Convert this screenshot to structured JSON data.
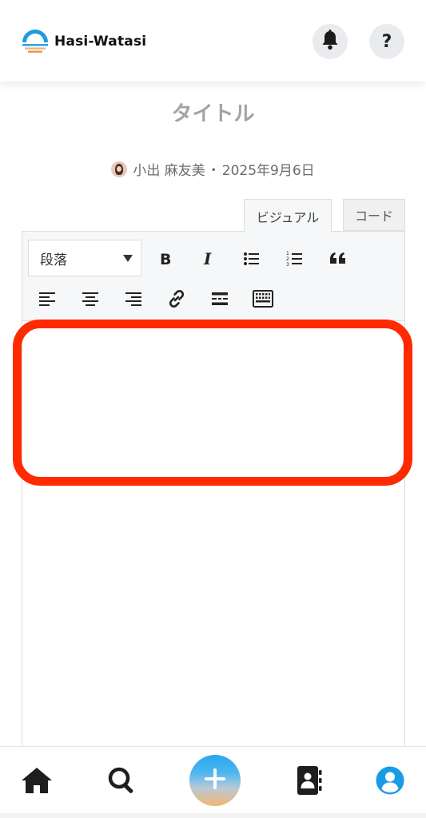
{
  "app": {
    "name": "Hasi-Watasi"
  },
  "header": {
    "notifications_icon": "bell-icon",
    "help_label": "?"
  },
  "post": {
    "title_placeholder": "タイトル",
    "author": "小出 麻友美",
    "separator": "・",
    "date": "2025年9月6日"
  },
  "editor": {
    "tabs": [
      {
        "label": "ビジュアル",
        "active": true
      },
      {
        "label": "コード",
        "active": false
      }
    ],
    "format_select": {
      "value": "段落"
    },
    "toolbar_row1": [
      "bold-icon",
      "italic-icon",
      "bulleted-list-icon",
      "numbered-list-icon",
      "blockquote-icon"
    ],
    "toolbar_row2": [
      "align-left-icon",
      "align-center-icon",
      "align-right-icon",
      "link-icon",
      "read-more-icon",
      "toolbar-toggle-icon"
    ],
    "content": ""
  },
  "bottom_nav": {
    "items": [
      "home-icon",
      "search-icon",
      "add-post-icon",
      "contacts-book-icon",
      "profile-icon"
    ],
    "active": "profile-icon"
  },
  "colors": {
    "highlight": "#ff2a00",
    "active_nav": "#1a9be6",
    "title_placeholder": "#a3a3a3"
  }
}
